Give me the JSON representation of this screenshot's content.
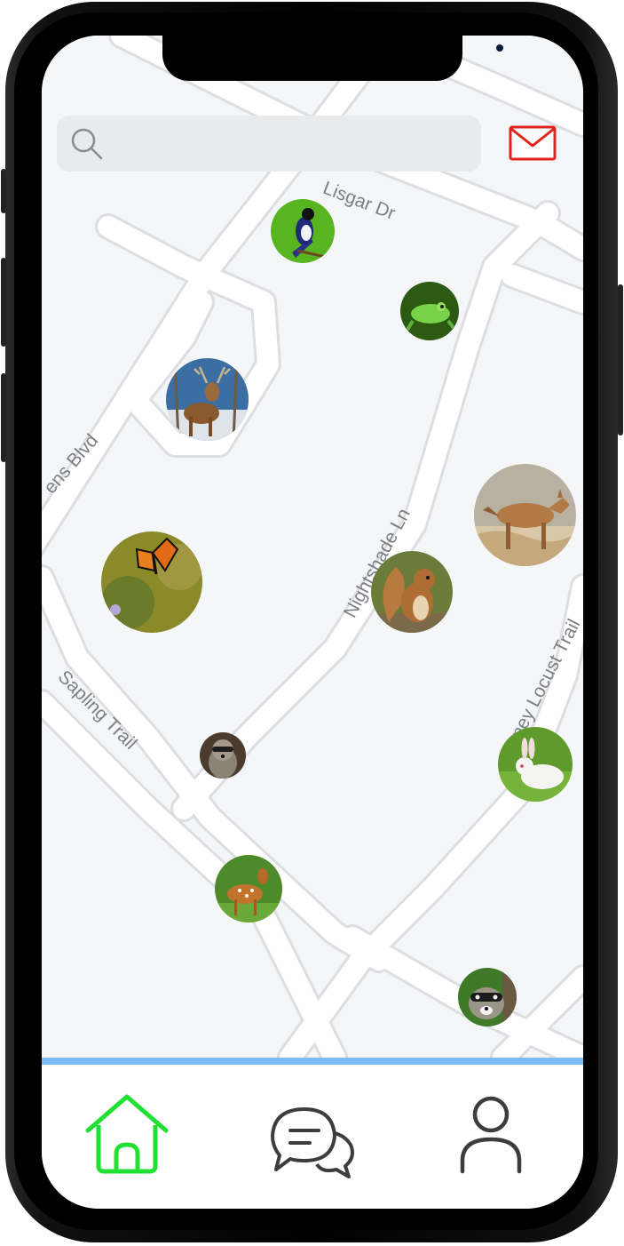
{
  "search": {
    "placeholder": ""
  },
  "streets": {
    "lisgar": "Lisgar Dr",
    "blvd": "ens Blvd",
    "nightshade": "Nightshade Ln",
    "sapling": "Sapling Trail",
    "honey": "Honey Locust Trail",
    "edge": "e"
  },
  "markers": [
    {
      "name": "magpie"
    },
    {
      "name": "frog"
    },
    {
      "name": "deer"
    },
    {
      "name": "coyote"
    },
    {
      "name": "butterfly"
    },
    {
      "name": "squirrel"
    },
    {
      "name": "raccoon"
    },
    {
      "name": "rabbit"
    },
    {
      "name": "fawn"
    },
    {
      "name": "raccoon"
    }
  ],
  "tabs": [
    {
      "name": "home",
      "active": true
    },
    {
      "name": "chat",
      "active": false
    },
    {
      "name": "profile",
      "active": false
    }
  ],
  "colors": {
    "active_tab": "#22e033",
    "inactive_tab": "#3d3d3d",
    "mail": "#e0241b",
    "tab_divider": "#7bbcf2",
    "map_background": "#f5f6f8",
    "road": "#ffffff",
    "road_edge": "#dcdee2"
  }
}
